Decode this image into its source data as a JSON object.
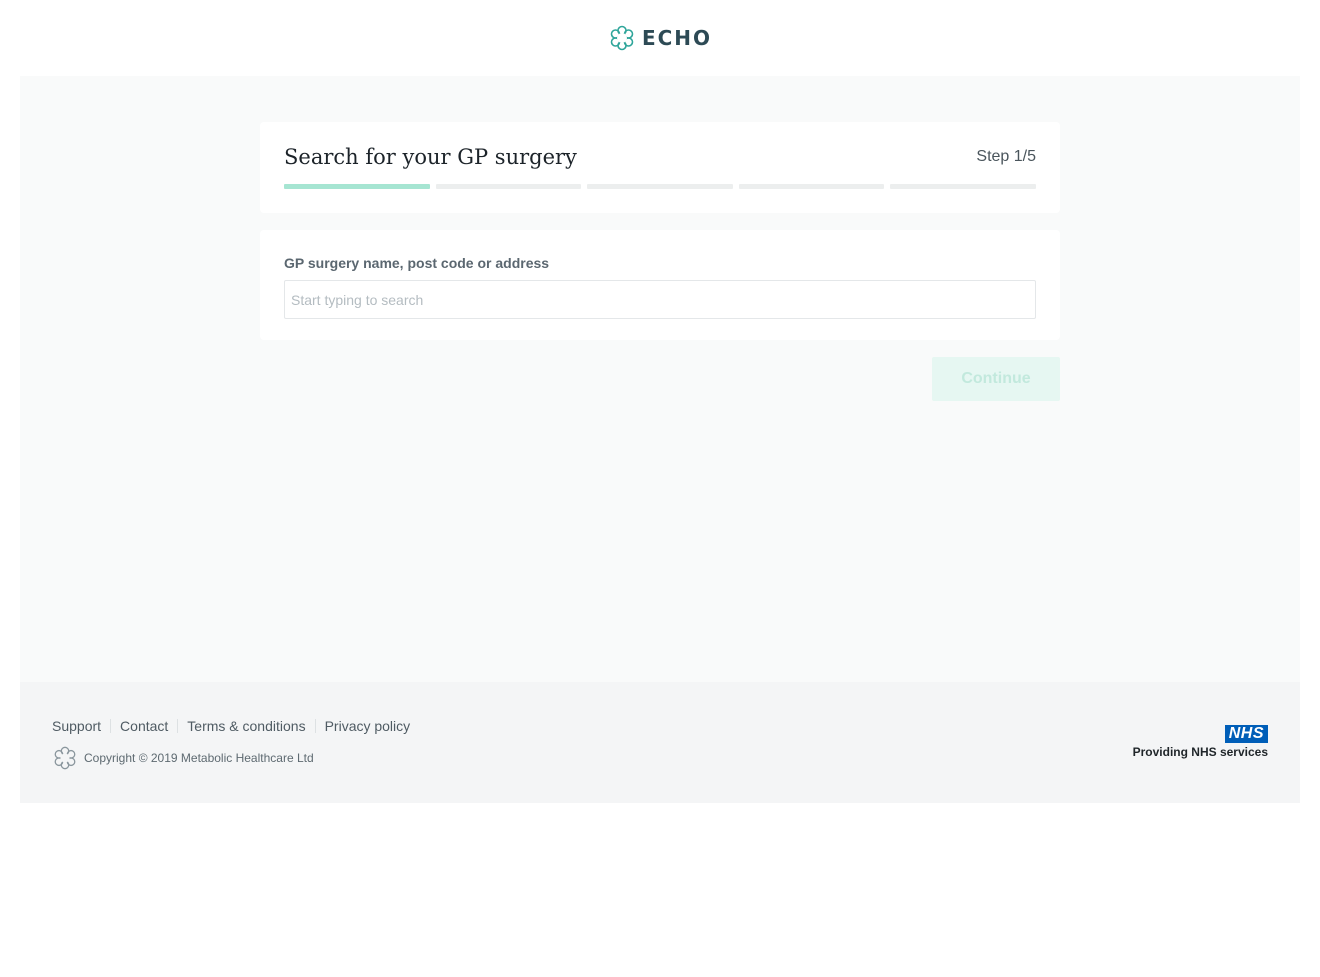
{
  "brand": {
    "name": "ECHO",
    "logo_icon": "echo-flower-icon",
    "accent": "#2ea59a"
  },
  "step": {
    "title": "Search for your GP surgery",
    "count_label": "Step 1/5",
    "current": 1,
    "total": 5
  },
  "search": {
    "label": "GP surgery name, post code or address",
    "placeholder": "Start typing to search",
    "value": ""
  },
  "actions": {
    "continue_label": "Continue"
  },
  "footer": {
    "links": [
      {
        "label": "Support"
      },
      {
        "label": "Contact"
      },
      {
        "label": "Terms & conditions"
      },
      {
        "label": "Privacy policy"
      }
    ],
    "copyright": "Copyright © 2019 Metabolic Healthcare Ltd",
    "nhs_logo": "NHS",
    "nhs_tagline": "Providing NHS services"
  },
  "colors": {
    "progress_done": "#a6e5d2",
    "progress_pending": "#eceeee",
    "nhs_blue": "#005eb8",
    "button_disabled_bg": "#e6f7f2"
  }
}
